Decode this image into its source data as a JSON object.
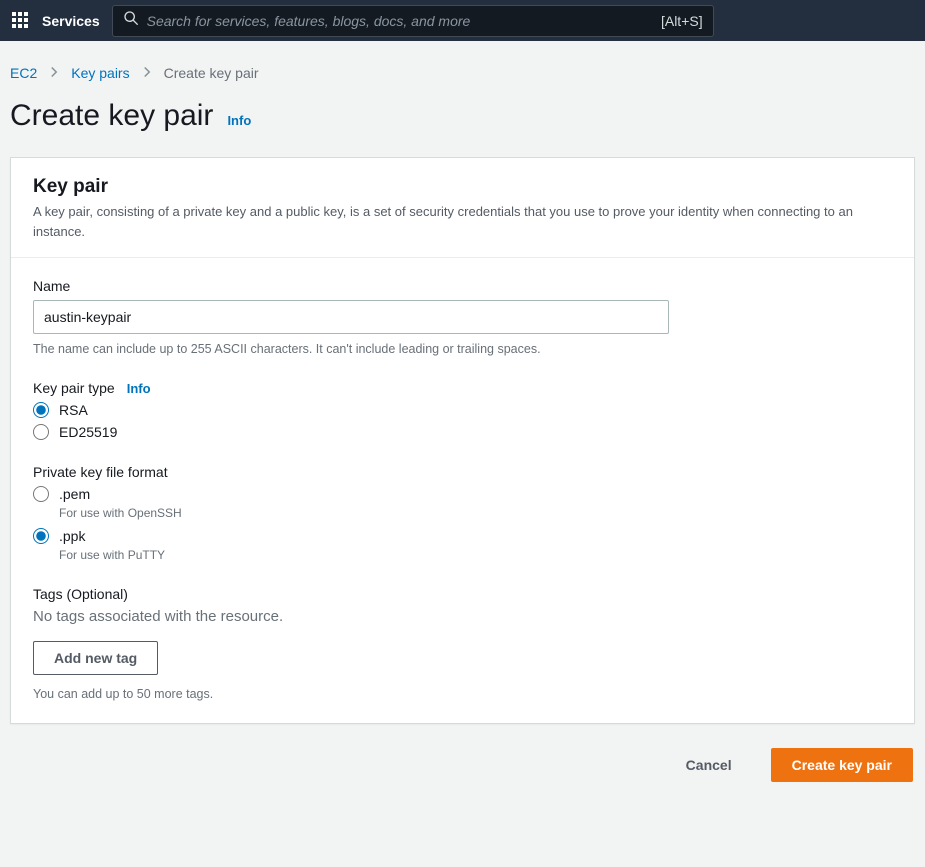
{
  "nav": {
    "services": "Services",
    "search_placeholder": "Search for services, features, blogs, docs, and more",
    "shortcut": "[Alt+S]"
  },
  "breadcrumb": {
    "root": "EC2",
    "parent": "Key pairs",
    "current": "Create key pair"
  },
  "page": {
    "title": "Create key pair",
    "info": "Info"
  },
  "panel": {
    "title": "Key pair",
    "description": "A key pair, consisting of a private key and a public key, is a set of security credentials that you use to prove your identity when connecting to an instance."
  },
  "name_field": {
    "label": "Name",
    "value": "austin-keypair",
    "hint": "The name can include up to 255 ASCII characters. It can't include leading or trailing spaces."
  },
  "keytype": {
    "label": "Key pair type",
    "info": "Info",
    "options": [
      {
        "label": "RSA",
        "checked": true
      },
      {
        "label": "ED25519",
        "checked": false
      }
    ]
  },
  "format": {
    "label": "Private key file format",
    "options": [
      {
        "label": ".pem",
        "sub": "For use with OpenSSH",
        "checked": false
      },
      {
        "label": ".ppk",
        "sub": "For use with PuTTY",
        "checked": true
      }
    ]
  },
  "tags": {
    "label": "Tags (Optional)",
    "empty": "No tags associated with the resource.",
    "add_btn": "Add new tag",
    "hint": "You can add up to 50 more tags."
  },
  "actions": {
    "cancel": "Cancel",
    "create": "Create key pair"
  }
}
